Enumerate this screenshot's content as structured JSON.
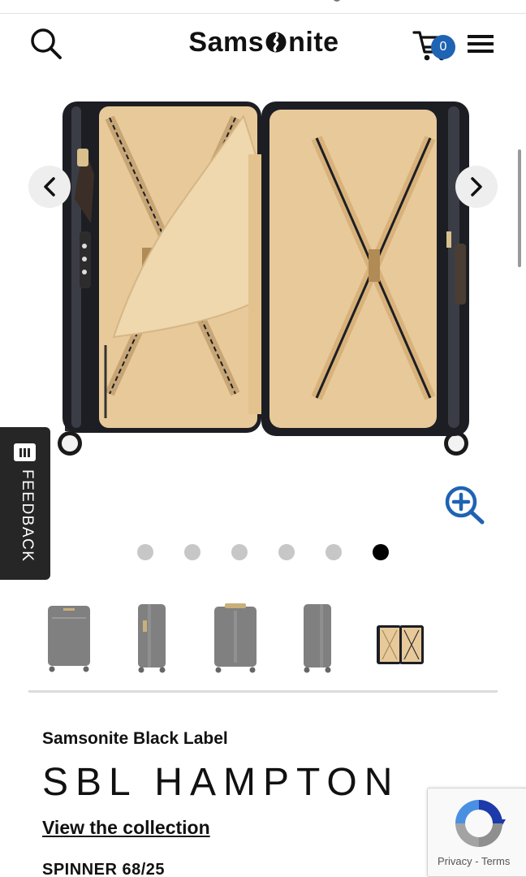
{
  "header": {
    "logo_text_left": "Sams",
    "logo_text_right": "nite",
    "cart_count": "0",
    "icons": [
      "search-icon",
      "cart-icon",
      "hamburger-menu-icon"
    ]
  },
  "gallery": {
    "prev_icon": "chevron-left-icon",
    "next_icon": "chevron-right-icon",
    "zoom_icon": "zoom-in-icon",
    "slide_count": 6,
    "active_slide": 6,
    "thumbnails": [
      "front view",
      "side view",
      "back view",
      "side view",
      "open interior view"
    ]
  },
  "feedback": {
    "label": "FEEDBACK"
  },
  "product": {
    "brand": "Samsonite Black Label",
    "name": "SBL HAMPTON",
    "collection_link": "View the collection",
    "variant": "SPINNER 68/25"
  },
  "recaptcha": {
    "privacy": "Privacy",
    "separator": " - ",
    "terms": "Terms"
  },
  "colors": {
    "accent": "#1f63b3",
    "lining": "#e8c99a",
    "shell": "#1c1e24",
    "dot_inactive": "#c7c7c7",
    "dot_active": "#000000"
  }
}
